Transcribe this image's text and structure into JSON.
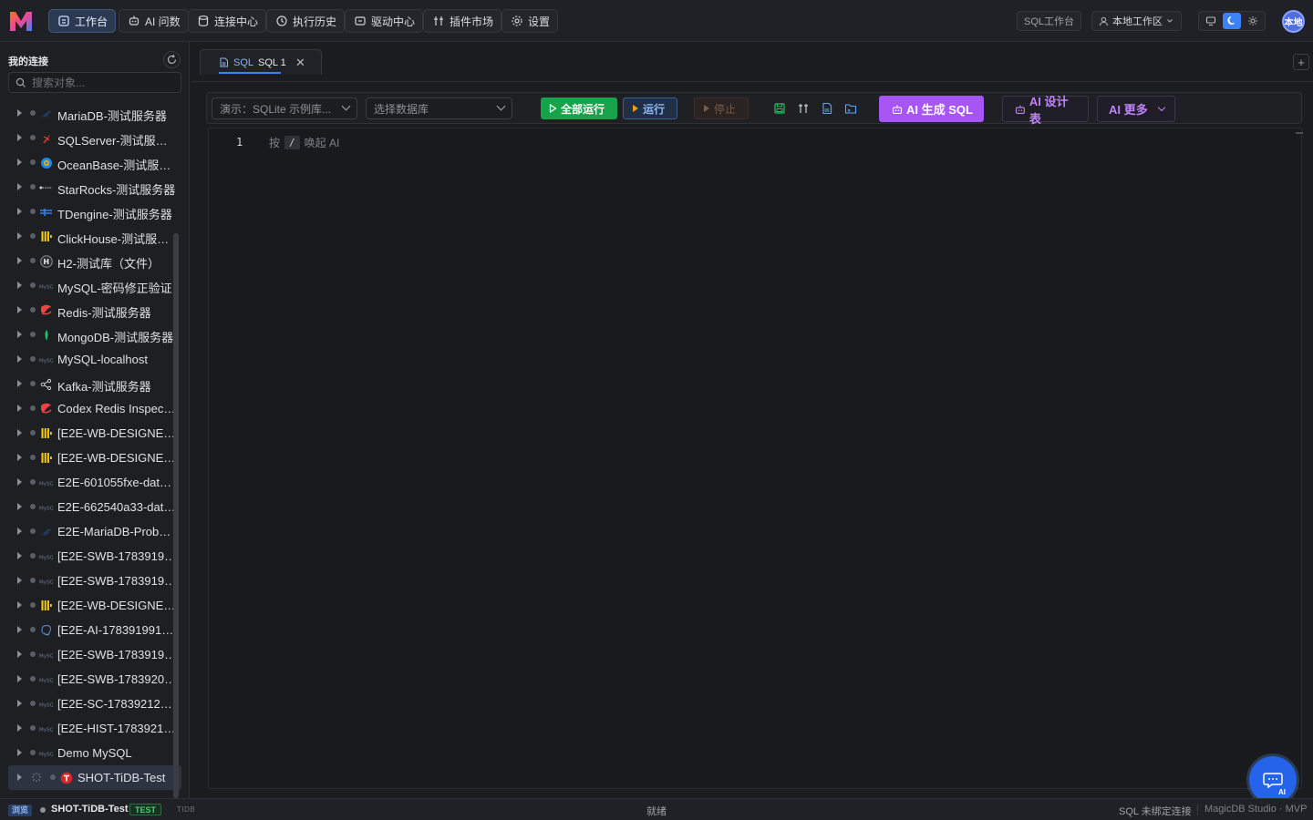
{
  "nav": {
    "items": [
      {
        "label": "工作台",
        "icon": "workspace-icon",
        "active": true
      },
      {
        "label": "AI 问数",
        "icon": "robot-icon",
        "active": false
      },
      {
        "label": "连接中心",
        "icon": "database-icon",
        "active": false
      },
      {
        "label": "执行历史",
        "icon": "history-icon",
        "active": false
      },
      {
        "label": "驱动中心",
        "icon": "driver-icon",
        "active": false
      },
      {
        "label": "插件市场",
        "icon": "plugin-icon",
        "active": false
      },
      {
        "label": "设置",
        "icon": "gear-icon",
        "active": false
      }
    ],
    "sql_workspace_label": "SQL工作台",
    "workspace_label": "本地工作区",
    "avatar_text": "本地",
    "theme_selected": "dark"
  },
  "sidebar": {
    "title": "我的连接",
    "search_placeholder": "搜索对象...",
    "connections": [
      {
        "label": "MariaDB-测试服务器",
        "icon": "mariadb-icon"
      },
      {
        "label": "SQLServer-测试服务器",
        "icon": "sqlserver-icon"
      },
      {
        "label": "OceanBase-测试服务...",
        "icon": "oceanbase-icon"
      },
      {
        "label": "StarRocks-测试服务器",
        "icon": "starrocks-icon"
      },
      {
        "label": "TDengine-测试服务器",
        "icon": "tdengine-icon"
      },
      {
        "label": "ClickHouse-测试服务...",
        "icon": "clickhouse-icon"
      },
      {
        "label": "H2-测试库（文件）",
        "icon": "h2-icon"
      },
      {
        "label": "MySQL-密码修正验证",
        "icon": "mysql-icon"
      },
      {
        "label": "Redis-测试服务器",
        "icon": "redis-icon"
      },
      {
        "label": "MongoDB-测试服务器",
        "icon": "mongodb-icon"
      },
      {
        "label": "MySQL-localhost",
        "icon": "mysql-icon"
      },
      {
        "label": "Kafka-测试服务器",
        "icon": "kafka-icon"
      },
      {
        "label": "Codex Redis Inspect ...",
        "icon": "redis-icon"
      },
      {
        "label": "[E2E-WB-DESIGNER-...",
        "icon": "clickhouse-icon"
      },
      {
        "label": "[E2E-WB-DESIGNER-...",
        "icon": "clickhouse-icon"
      },
      {
        "label": "E2E-601055fxe-data-...",
        "icon": "mysql-icon"
      },
      {
        "label": "E2E-662540a33-data...",
        "icon": "mysql-icon"
      },
      {
        "label": "E2E-MariaDB-Probe-...",
        "icon": "mariadb-icon"
      },
      {
        "label": "[E2E-SWB-17839194...",
        "icon": "mysql-icon"
      },
      {
        "label": "[E2E-SWB-17839196...",
        "icon": "mysql-icon"
      },
      {
        "label": "[E2E-WB-DESIGNER-...",
        "icon": "clickhouse-icon"
      },
      {
        "label": "[E2E-AI-1783919912...",
        "icon": "postgresql-icon"
      },
      {
        "label": "[E2E-SWB-17839199...",
        "icon": "mysql-icon"
      },
      {
        "label": "[E2E-SWB-17839206...",
        "icon": "mysql-icon"
      },
      {
        "label": "[E2E-SC-1783921214...",
        "icon": "mysql-icon"
      },
      {
        "label": "[E2E-HIST-17839212...",
        "icon": "mysql-icon"
      },
      {
        "label": "Demo MySQL",
        "icon": "mysql-icon"
      },
      {
        "label": "SHOT-TiDB-Test",
        "icon": "tidb-icon",
        "selected": true
      }
    ]
  },
  "tabs": [
    {
      "badge": "SQL",
      "label": "SQL 1",
      "active": true
    }
  ],
  "toolbar": {
    "connection_select": "演示：SQLite 示例库...",
    "database_select_placeholder": "选择数据库",
    "run_all_label": "全部运行",
    "run_label": "运行",
    "stop_label": "停止",
    "icons": [
      "save-icon",
      "format-icon",
      "sql-file-icon",
      "folder-icon"
    ],
    "ai_generate_label": "AI 生成 SQL",
    "ai_design_label": "AI 设计表",
    "ai_more_label": "AI 更多"
  },
  "editor": {
    "line_number": "1",
    "hint_prefix": "按",
    "hint_key": "/",
    "hint_suffix": "唤起 AI"
  },
  "fab": {
    "label": "AI"
  },
  "statusbar": {
    "mode": "浏览",
    "connection": "SHOT-TiDB-Test",
    "env": "TEST",
    "db_type": "TIDB",
    "status": "就绪",
    "binding": "SQL 未绑定连接",
    "app": "MagicDB Studio · MVP"
  }
}
